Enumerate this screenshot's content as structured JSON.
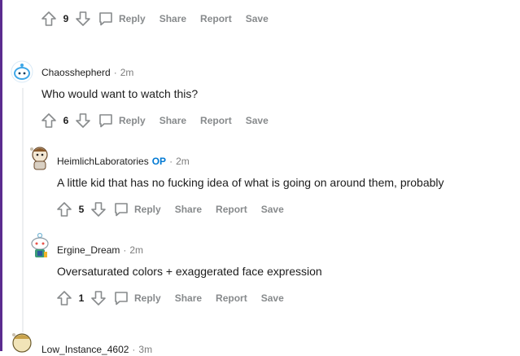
{
  "actions": {
    "reply": "Reply",
    "share": "Share",
    "report": "Report",
    "save": "Save"
  },
  "comments": [
    {
      "score": "9"
    },
    {
      "username": "Chaosshepherd",
      "time": "2m",
      "text": "Who would want to watch this?",
      "score": "6"
    },
    {
      "username": "HeimlichLaboratories",
      "badge": "OP",
      "time": "2m",
      "text": "A little kid that has no fucking idea of what is going on around them, probably",
      "score": "5"
    },
    {
      "username": "Ergine_Dream",
      "time": "2m",
      "text": "Oversaturated colors + exaggerated face expression",
      "score": "1"
    },
    {
      "username": "Low_Instance_4602",
      "time": "3m"
    }
  ],
  "dot": "·",
  "colors": {
    "accent": "#5b2c8f",
    "op": "#0079d3",
    "meta": "#878a8c"
  }
}
